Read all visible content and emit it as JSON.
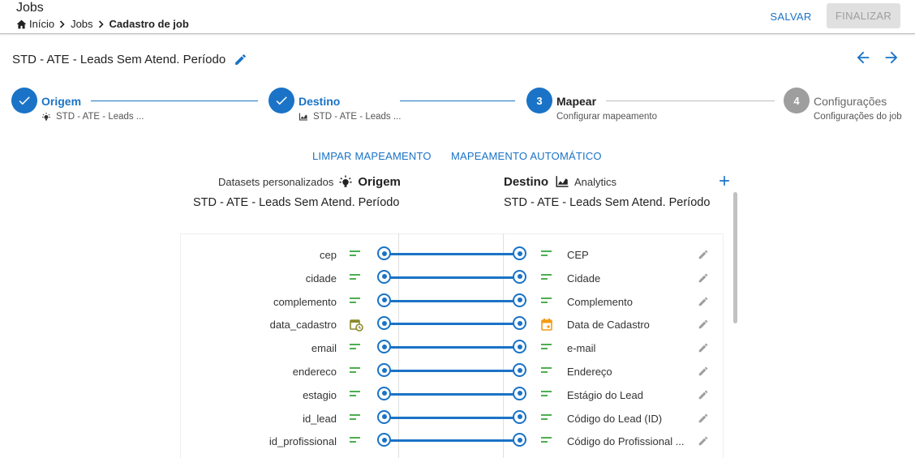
{
  "header": {
    "title": "Jobs",
    "breadcrumb": [
      "Início",
      "Jobs",
      "Cadastro de job"
    ],
    "save_label": "SALVAR",
    "finalize_label": "FINALIZAR"
  },
  "job": {
    "title": "STD - ATE - Leads Sem Atend. Período"
  },
  "steps": [
    {
      "label": "Origem",
      "sub": "STD - ATE - Leads ...",
      "state": "done"
    },
    {
      "label": "Destino",
      "sub": "STD - ATE - Leads ...",
      "state": "done"
    },
    {
      "number": "3",
      "label": "Mapear",
      "sub": "Configurar mapeamento",
      "state": "current"
    },
    {
      "number": "4",
      "label": "Configurações",
      "sub": "Configurações do job",
      "state": "pending"
    }
  ],
  "actions": {
    "clear": "LIMPAR MAPEAMENTO",
    "auto": "MAPEAMENTO AUTOMÁTICO"
  },
  "source": {
    "category": "Datasets personalizados",
    "heading": "Origem",
    "dataset": "STD - ATE - Leads Sem Atend. Período"
  },
  "destination": {
    "heading": "Destino",
    "category": "Analytics",
    "dataset": "STD - ATE - Leads Sem Atend. Período"
  },
  "mappings": [
    {
      "source": "cep",
      "source_type": "text-icon",
      "dest": "CEP",
      "dest_type": "text-icon"
    },
    {
      "source": "cidade",
      "source_type": "text-icon",
      "dest": "Cidade",
      "dest_type": "text-icon"
    },
    {
      "source": "complemento",
      "source_type": "text-icon",
      "dest": "Complemento",
      "dest_type": "text-icon"
    },
    {
      "source": "data_cadastro",
      "source_type": "datetime-icon",
      "dest": "Data de Cadastro",
      "dest_type": "date-icon"
    },
    {
      "source": "email",
      "source_type": "text-icon",
      "dest": "e-mail",
      "dest_type": "text-icon"
    },
    {
      "source": "endereco",
      "source_type": "text-icon",
      "dest": "Endereço",
      "dest_type": "text-icon"
    },
    {
      "source": "estagio",
      "source_type": "text-icon",
      "dest": "Estágio do Lead",
      "dest_type": "text-icon"
    },
    {
      "source": "id_lead",
      "source_type": "text-icon",
      "dest": "Código do Lead (ID)",
      "dest_type": "text-icon"
    },
    {
      "source": "id_profissional",
      "source_type": "text-icon",
      "dest": "Código do Profissional ...",
      "dest_type": "text-icon"
    }
  ],
  "colors": {
    "primary": "#1a73c6",
    "text_type": "#4caf50",
    "datetime_type": "#8a8a2a",
    "date_type": "#f39c12",
    "disabled": "#e0e0e0"
  }
}
